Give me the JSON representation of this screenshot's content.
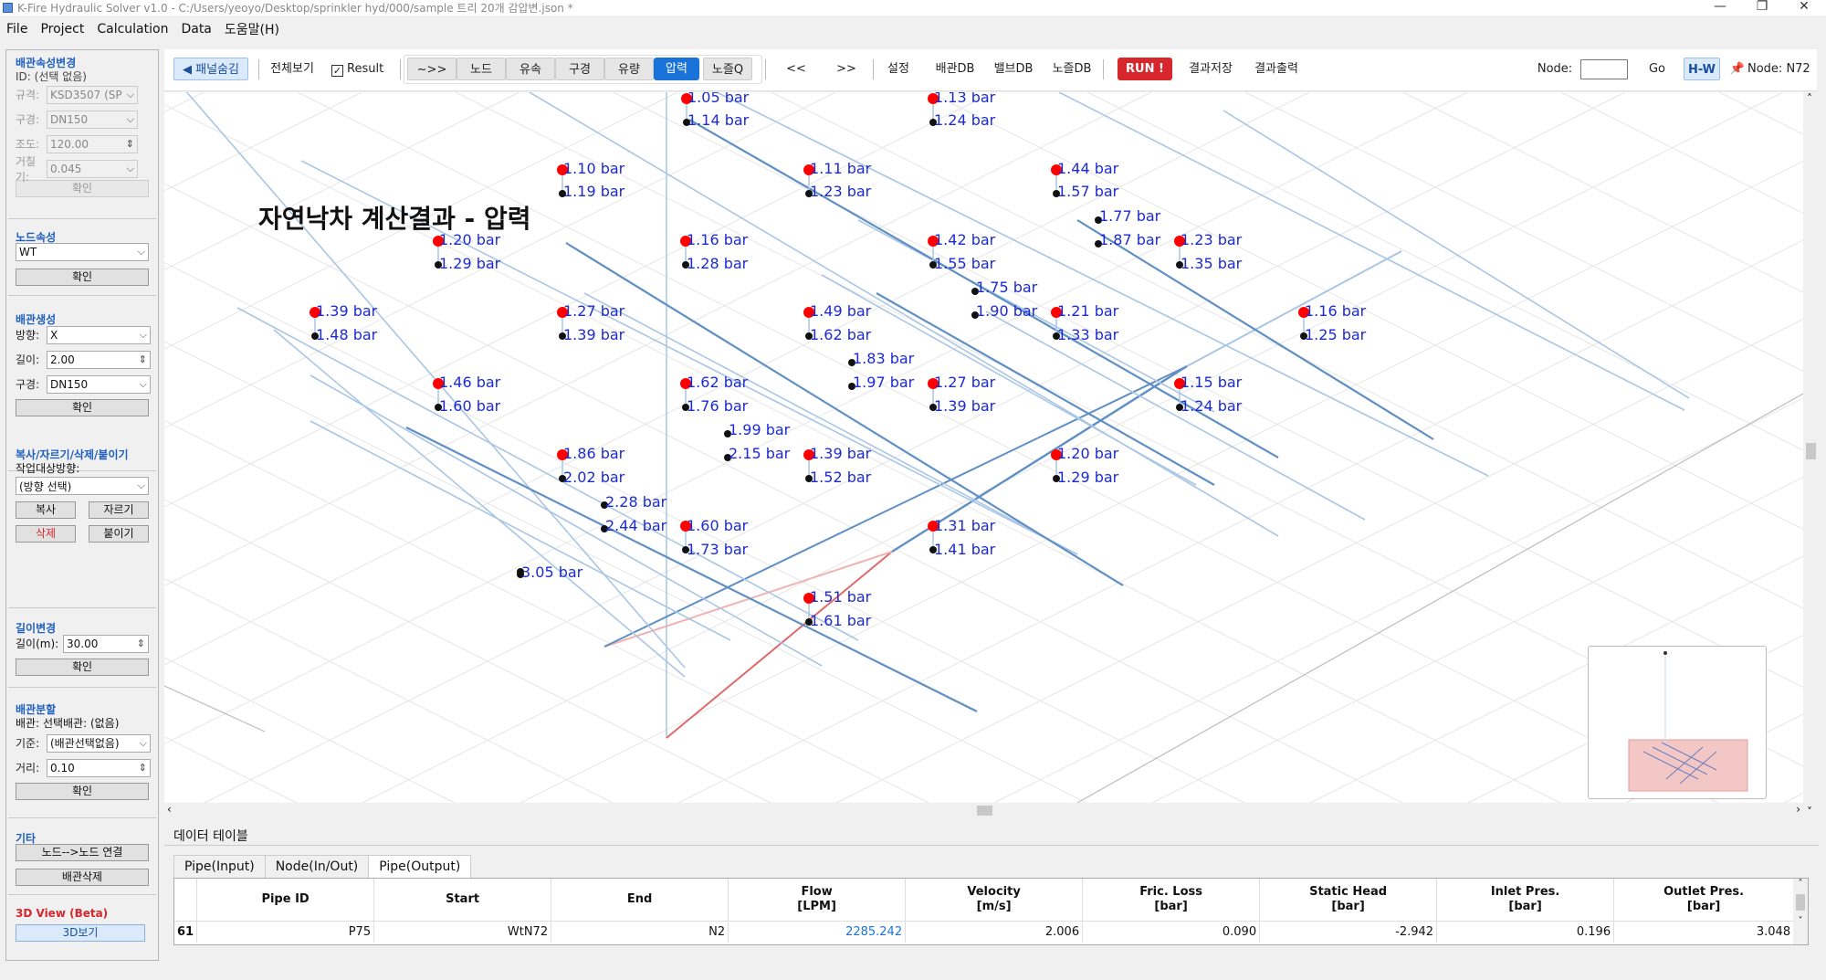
{
  "window": {
    "title": "K-Fire Hydraulic Solver v1.0 - C:/Users/yeoyo/Desktop/sprinkler hyd/000/sample 트리 20개 감압변.json *"
  },
  "menu": [
    "File",
    "Project",
    "Calculation",
    "Data",
    "도움말(H)"
  ],
  "left_panel": {
    "pipe_attr": {
      "title": "배관속성변경",
      "id_label": "ID: (선택 없음)",
      "std_label": "규격:",
      "std_value": "KSD3507 (SP",
      "dia_label": "구경:",
      "dia_value": "DN150",
      "c_label": "조도:",
      "c_value": "120.00",
      "rough_label": "거칠기:",
      "rough_value": "0.045",
      "ok": "확인"
    },
    "node_attr": {
      "title": "노드속성",
      "value": "WT",
      "ok": "확인"
    },
    "pipe_create": {
      "title": "배관생성",
      "dir_label": "방향:",
      "dir_value": "X",
      "len_label": "길이:",
      "len_value": "2.00",
      "dia_label": "구경:",
      "dia_value": "DN150",
      "ok": "확인"
    },
    "copy": {
      "title": "복사/자르기/삭제/붙이기",
      "target_label": "작업대상방향:",
      "target_value": "(방향 선택)",
      "copy": "복사",
      "cut": "자르기",
      "delete": "삭제",
      "paste": "붙이기"
    },
    "length": {
      "title": "길이변경",
      "label": "길이(m):",
      "value": "30.00",
      "ok": "확인"
    },
    "split": {
      "title": "배관분할",
      "sel_label": "배관: 선택배관: (없음)",
      "base_label": "기준:",
      "base_value": "(배관선택없음)",
      "dist_label": "거리:",
      "dist_value": "0.10",
      "ok": "확인"
    },
    "etc": {
      "title": "기타",
      "connect": "노드-->노드 연결",
      "delete_pipe": "배관삭제"
    },
    "view3d": {
      "title": "3D View (Beta)",
      "btn": "3D보기"
    }
  },
  "toolbar": {
    "hide_panel": "◀ 패널숨김",
    "view_all": "전체보기",
    "result": "Result",
    "groups": [
      "~>>",
      "노드",
      "유속",
      "구경",
      "유량",
      "압력",
      "노즐Q"
    ],
    "selected": "압력",
    "prev": "<<",
    "next": ">>",
    "settings": "설정",
    "pipe_db": "배관DB",
    "valve_db": "밸브DB",
    "nozzle_db": "노즐DB",
    "run": "RUN !",
    "save_result": "결과저장",
    "export_result": "결과출력",
    "node_label": "Node:",
    "node_input": "",
    "go": "Go",
    "hw": "H-W",
    "node_status": "Node: N72"
  },
  "view": {
    "title": "자연낙차 계산결과 - 압력",
    "labels": [
      "1.05 bar",
      "1.14 bar",
      "1.13 bar",
      "1.24 bar",
      "1.10 bar",
      "1.19 bar",
      "1.11 bar",
      "1.23 bar",
      "1.44 bar",
      "1.57 bar",
      "1.77 bar",
      "1.87 bar",
      "1.20 bar",
      "1.29 bar",
      "1.16 bar",
      "1.28 bar",
      "1.42 bar",
      "1.55 bar",
      "1.23 bar",
      "1.35 bar",
      "1.75 bar",
      "1.90 bar",
      "1.39 bar",
      "1.48 bar",
      "1.27 bar",
      "1.39 bar",
      "1.49 bar",
      "1.62 bar",
      "1.21 bar",
      "1.33 bar",
      "1.16 bar",
      "1.25 bar",
      "1.83 bar",
      "1.97 bar",
      "1.46 bar",
      "1.60 bar",
      "1.62 bar",
      "1.76 bar",
      "1.27 bar",
      "1.39 bar",
      "1.15 bar",
      "1.24 bar",
      "1.99 bar",
      "2.15 bar",
      "1.86 bar",
      "2.02 bar",
      "1.39 bar",
      "1.52 bar",
      "1.20 bar",
      "1.29 bar",
      "2.28 bar",
      "2.44 bar",
      "1.60 bar",
      "1.73 bar",
      "1.31 bar",
      "1.41 bar",
      "3.05 bar",
      "1.51 bar",
      "1.61 bar"
    ]
  },
  "data_table": {
    "title": "데이터 테이블",
    "tabs": [
      "Pipe(Input)",
      "Node(In/Out)",
      "Pipe(Output)"
    ],
    "active_tab": "Pipe(Output)",
    "headers": [
      "Pipe ID",
      "Start",
      "End",
      "Flow\n[LPM]",
      "Velocity\n[m/s]",
      "Fric. Loss\n[bar]",
      "Static Head\n[bar]",
      "Inlet Pres.\n[bar]",
      "Outlet Pres.\n[bar]"
    ],
    "rows": [
      {
        "index": "61",
        "cells": [
          "P75",
          "WtN72",
          "N2",
          "2285.242",
          "2.006",
          "0.090",
          "-2.942",
          "0.196",
          "3.048"
        ]
      }
    ]
  },
  "colors": {
    "accent": "#1a73d9",
    "run": "#d7262c",
    "label": "#1c2bd0",
    "pipe_main": "#5f8fc4",
    "pipe_light": "#a9c6e4",
    "pipe_hot": "#e06a6a",
    "sprinkler": "#ff0000"
  }
}
